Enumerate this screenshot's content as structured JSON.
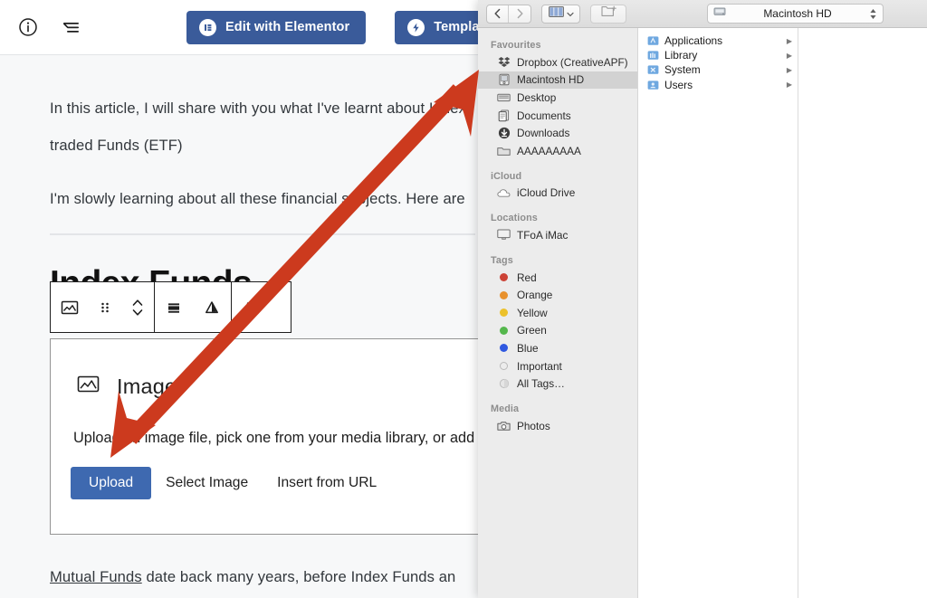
{
  "editor": {
    "toolbar": {
      "info_icon": "info-circle-icon",
      "list_view_icon": "list-view-icon",
      "elementor_label": "Edit with Elementor",
      "elementor_badge_icon": "elementor-logo-icon",
      "kits_label": "Template Kits",
      "kits_badge_icon": "lightning-bolt-icon",
      "accent_color": "#3a5b9a"
    },
    "content": {
      "paragraph_1": "In this article, I will share with you what I've learnt about Index Funds and Exchange traded Funds (ETF)",
      "paragraph_1_line_1": "In this article, I will share with you what I've learnt about Index",
      "paragraph_1_line_2": "traded Funds (ETF)",
      "paragraph_2": "I'm slowly learning about all these financial subjects. Here are",
      "heading": "Index Funds",
      "paragraph_3_link": "Mutual Funds",
      "paragraph_3_rest": " date back many years, before Index Funds an"
    },
    "block_toolbar": {
      "image_icon": "image-block-icon",
      "drag_icon": "drag-handle-icon",
      "move_icon": "move-up-down-icon",
      "align_icon": "align-icon",
      "transform_icon": "change-block-type-icon",
      "more_icon": "more-options-icon"
    },
    "image_block": {
      "icon": "image-placeholder-icon",
      "title": "Image",
      "description": "Upload an image file, pick one from your media library, or add one with a URL.",
      "upload_label": "Upload",
      "select_label": "Select Image",
      "url_label": "Insert from URL",
      "upload_color": "#3e69b0"
    }
  },
  "finder": {
    "toolbar": {
      "back_icon": "chevron-left-icon",
      "forward_icon": "chevron-right-icon",
      "view_icon": "column-view-icon",
      "view_chevron_icon": "chevron-down-icon",
      "group_icon": "new-folder-icon",
      "path_label": "Macintosh HD",
      "path_icon": "hard-drive-icon",
      "path_stepper_icon": "stepper-updown-icon"
    },
    "sidebar": {
      "sections": [
        {
          "title": "Favourites",
          "items": [
            {
              "label": "Dropbox (CreativeAPF)",
              "icon": "dropbox-icon",
              "selected": false
            },
            {
              "label": "Macintosh HD",
              "icon": "hard-drive-icon",
              "selected": true
            },
            {
              "label": "Desktop",
              "icon": "desktop-icon",
              "selected": false
            },
            {
              "label": "Documents",
              "icon": "documents-icon",
              "selected": false
            },
            {
              "label": "Downloads",
              "icon": "downloads-icon",
              "selected": false
            },
            {
              "label": "AAAAAAAAA",
              "icon": "folder-icon",
              "selected": false
            }
          ]
        },
        {
          "title": "iCloud",
          "items": [
            {
              "label": "iCloud Drive",
              "icon": "cloud-icon",
              "selected": false
            }
          ]
        },
        {
          "title": "Locations",
          "items": [
            {
              "label": "TFoA iMac",
              "icon": "imac-icon",
              "selected": false
            }
          ]
        },
        {
          "title": "Tags",
          "items": [
            {
              "label": "Red",
              "icon": "tag-dot-icon",
              "color": "#cc4236",
              "selected": false
            },
            {
              "label": "Orange",
              "icon": "tag-dot-icon",
              "color": "#e8912d",
              "selected": false
            },
            {
              "label": "Yellow",
              "icon": "tag-dot-icon",
              "color": "#ecc12b",
              "selected": false
            },
            {
              "label": "Green",
              "icon": "tag-dot-icon",
              "color": "#54b74c",
              "selected": false
            },
            {
              "label": "Blue",
              "icon": "tag-dot-icon",
              "color": "#2f58e0",
              "selected": false
            },
            {
              "label": "Important",
              "icon": "tag-dot-hollow-icon",
              "color": "",
              "selected": false
            },
            {
              "label": "All Tags…",
              "icon": "all-tags-icon",
              "color": "",
              "selected": false
            }
          ]
        },
        {
          "title": "Media",
          "items": [
            {
              "label": "Photos",
              "icon": "photos-camera-icon",
              "selected": false
            }
          ]
        }
      ]
    },
    "filelist": {
      "items": [
        {
          "label": "Applications",
          "icon": "applications-folder-icon",
          "chevron": "▶"
        },
        {
          "label": "Library",
          "icon": "library-folder-icon",
          "chevron": "▶"
        },
        {
          "label": "System",
          "icon": "system-folder-icon",
          "chevron": "▶"
        },
        {
          "label": "Users",
          "icon": "users-folder-icon",
          "chevron": "▶"
        }
      ]
    }
  },
  "annotation": {
    "arrow_icon": "double-headed-arrow-annotation",
    "arrow_color": "#cc3a1e",
    "points_from": "Upload",
    "points_to": "Macintosh HD"
  }
}
